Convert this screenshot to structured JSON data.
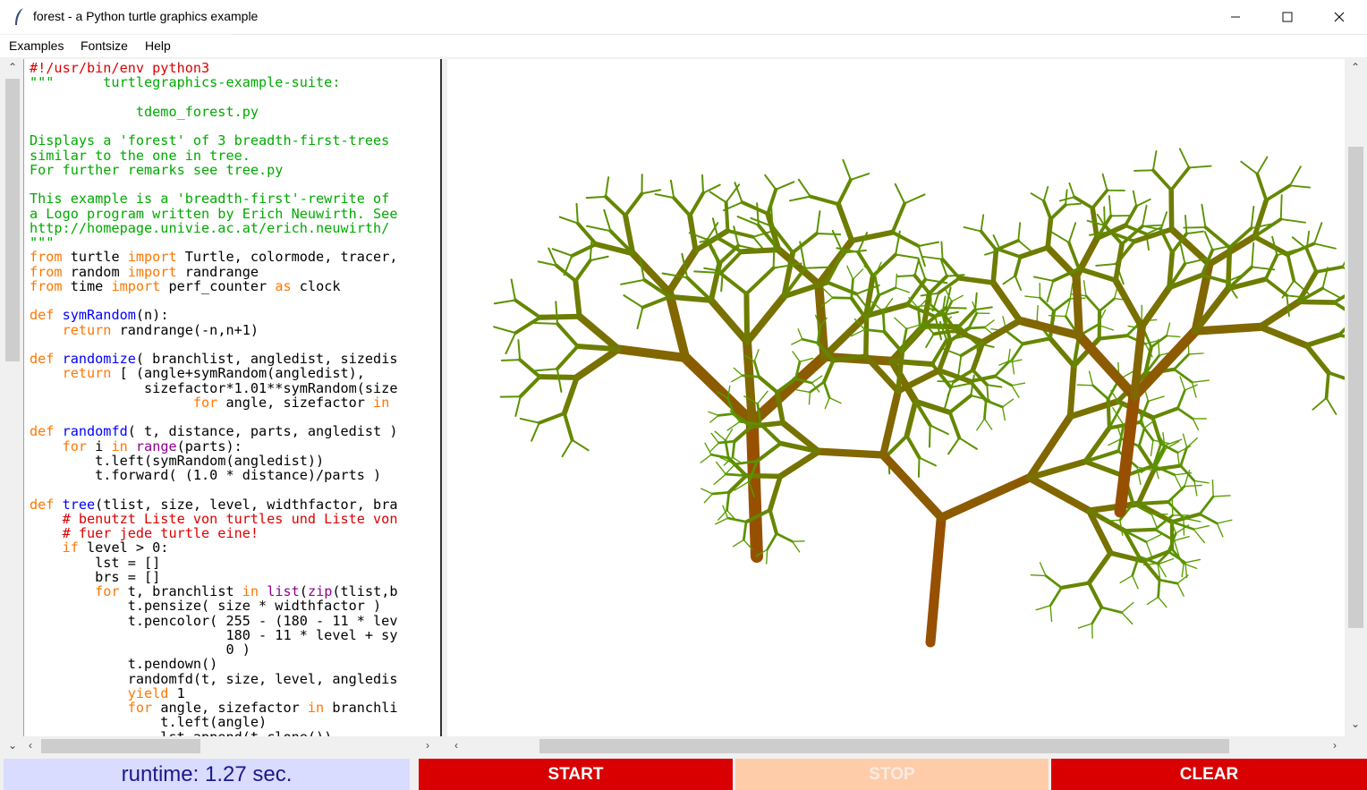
{
  "window": {
    "title": "forest - a Python turtle graphics example",
    "controls": [
      "minimize",
      "maximize",
      "close"
    ]
  },
  "menu": [
    "Examples",
    "Fontsize",
    "Help"
  ],
  "code_lines": [
    [
      [
        "#!/usr/bin/env python3",
        "#dd0000"
      ]
    ],
    [
      [
        "\"\"\"      turtlegraphics-example-suite:",
        "#00aa00"
      ]
    ],
    [
      [
        "",
        "#000"
      ]
    ],
    [
      [
        "             tdemo_forest.py",
        "#00aa00"
      ]
    ],
    [
      [
        "",
        "#000"
      ]
    ],
    [
      [
        "Displays a 'forest' of 3 breadth-first-trees",
        "#00aa00"
      ]
    ],
    [
      [
        "similar to the one in tree.",
        "#00aa00"
      ]
    ],
    [
      [
        "For further remarks see tree.py",
        "#00aa00"
      ]
    ],
    [
      [
        "",
        "#000"
      ]
    ],
    [
      [
        "This example is a 'breadth-first'-rewrite of",
        "#00aa00"
      ]
    ],
    [
      [
        "a Logo program written by Erich Neuwirth. See",
        "#00aa00"
      ]
    ],
    [
      [
        "http://homepage.univie.ac.at/erich.neuwirth/",
        "#00aa00"
      ]
    ],
    [
      [
        "\"\"\"",
        "#00aa00"
      ]
    ],
    [
      [
        "from",
        "#ff7700"
      ],
      [
        " turtle ",
        "#000"
      ],
      [
        "import",
        "#ff7700"
      ],
      [
        " Turtle, colormode, tracer,",
        "#000"
      ]
    ],
    [
      [
        "from",
        "#ff7700"
      ],
      [
        " random ",
        "#000"
      ],
      [
        "import",
        "#ff7700"
      ],
      [
        " randrange",
        "#000"
      ]
    ],
    [
      [
        "from",
        "#ff7700"
      ],
      [
        " time ",
        "#000"
      ],
      [
        "import",
        "#ff7700"
      ],
      [
        " perf_counter ",
        "#000"
      ],
      [
        "as",
        "#ff7700"
      ],
      [
        " clock",
        "#000"
      ]
    ],
    [
      [
        "",
        "#000"
      ]
    ],
    [
      [
        "def",
        "#ff7700"
      ],
      [
        " ",
        "#000"
      ],
      [
        "symRandom",
        "#0000ff"
      ],
      [
        "(n):",
        "#000"
      ]
    ],
    [
      [
        "    ",
        "#000"
      ],
      [
        "return",
        "#ff7700"
      ],
      [
        " randrange(-n,n+1)",
        "#000"
      ]
    ],
    [
      [
        "",
        "#000"
      ]
    ],
    [
      [
        "def",
        "#ff7700"
      ],
      [
        " ",
        "#000"
      ],
      [
        "randomize",
        "#0000ff"
      ],
      [
        "( branchlist, angledist, sizedis",
        "#000"
      ]
    ],
    [
      [
        "    ",
        "#000"
      ],
      [
        "return",
        "#ff7700"
      ],
      [
        " [ (angle+symRandom(angledist),",
        "#000"
      ]
    ],
    [
      [
        "              sizefactor*1.01**symRandom(size",
        "#000"
      ]
    ],
    [
      [
        "                    ",
        "#000"
      ],
      [
        "for",
        "#ff7700"
      ],
      [
        " angle, sizefactor ",
        "#000"
      ],
      [
        "in",
        "#ff7700"
      ]
    ],
    [
      [
        "",
        "#000"
      ]
    ],
    [
      [
        "def",
        "#ff7700"
      ],
      [
        " ",
        "#000"
      ],
      [
        "randomfd",
        "#0000ff"
      ],
      [
        "( t, distance, parts, angledist )",
        "#000"
      ]
    ],
    [
      [
        "    ",
        "#000"
      ],
      [
        "for",
        "#ff7700"
      ],
      [
        " i ",
        "#000"
      ],
      [
        "in",
        "#ff7700"
      ],
      [
        " ",
        "#000"
      ],
      [
        "range",
        "#900090"
      ],
      [
        "(parts):",
        "#000"
      ]
    ],
    [
      [
        "        t.left(symRandom(angledist))",
        "#000"
      ]
    ],
    [
      [
        "        t.forward( (1.0 * distance)/parts )",
        "#000"
      ]
    ],
    [
      [
        "",
        "#000"
      ]
    ],
    [
      [
        "def",
        "#ff7700"
      ],
      [
        " ",
        "#000"
      ],
      [
        "tree",
        "#0000ff"
      ],
      [
        "(tlist, size, level, widthfactor, bra",
        "#000"
      ]
    ],
    [
      [
        "    # benutzt Liste von turtles und Liste von",
        "#dd0000"
      ]
    ],
    [
      [
        "    # fuer jede turtle eine!",
        "#dd0000"
      ]
    ],
    [
      [
        "    ",
        "#000"
      ],
      [
        "if",
        "#ff7700"
      ],
      [
        " level > 0:",
        "#000"
      ]
    ],
    [
      [
        "        lst = []",
        "#000"
      ]
    ],
    [
      [
        "        brs = []",
        "#000"
      ]
    ],
    [
      [
        "        ",
        "#000"
      ],
      [
        "for",
        "#ff7700"
      ],
      [
        " t, branchlist ",
        "#000"
      ],
      [
        "in",
        "#ff7700"
      ],
      [
        " ",
        "#000"
      ],
      [
        "list",
        "#900090"
      ],
      [
        "(",
        "#000"
      ],
      [
        "zip",
        "#900090"
      ],
      [
        "(tlist,b",
        "#000"
      ]
    ],
    [
      [
        "            t.pensize( size * widthfactor )",
        "#000"
      ]
    ],
    [
      [
        "            t.pencolor( 255 - (180 - 11 * lev",
        "#000"
      ]
    ],
    [
      [
        "                        180 - 11 * level + sy",
        "#000"
      ]
    ],
    [
      [
        "                        0 )",
        "#000"
      ]
    ],
    [
      [
        "            t.pendown()",
        "#000"
      ]
    ],
    [
      [
        "            randomfd(t, size, level, angledis",
        "#000"
      ]
    ],
    [
      [
        "            ",
        "#000"
      ],
      [
        "yield",
        "#ff7700"
      ],
      [
        " 1",
        "#000"
      ]
    ],
    [
      [
        "            ",
        "#000"
      ],
      [
        "for",
        "#ff7700"
      ],
      [
        " angle, sizefactor ",
        "#000"
      ],
      [
        "in",
        "#ff7700"
      ],
      [
        " branchli",
        "#000"
      ]
    ],
    [
      [
        "                t.left(angle)",
        "#000"
      ]
    ],
    [
      [
        "                lst.append(t.clone())",
        "#000"
      ]
    ]
  ],
  "buttons": {
    "runtime": "runtime: 1.27 sec.",
    "start": "START",
    "stop": "STOP",
    "clear": "CLEAR"
  },
  "colors": {
    "button_active": "#d80000",
    "button_disabled": "#ffccaa",
    "runtime_bg": "#d9dbff",
    "trunk": "#9c5a00",
    "leaf": "#66aa00"
  }
}
